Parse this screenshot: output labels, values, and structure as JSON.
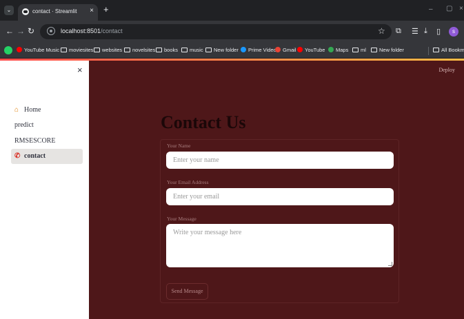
{
  "browser": {
    "tab_title": "contact · Streamlit",
    "tab_close": "×",
    "new_tab": "+",
    "url_host": "localhost:8501",
    "url_path": "/contact",
    "window_controls": {
      "minimize": "–",
      "maximize": "▢",
      "close": "×"
    }
  },
  "bookmarks": [
    {
      "label": "YouTube Music",
      "icon": "youtube-music-icon",
      "color": "#ff0000"
    },
    {
      "label": "moviesites",
      "icon": "folder-icon"
    },
    {
      "label": "websites",
      "icon": "folder-icon"
    },
    {
      "label": "novelsites",
      "icon": "folder-icon"
    },
    {
      "label": "books",
      "icon": "folder-icon"
    },
    {
      "label": "music",
      "icon": "folder-icon"
    },
    {
      "label": "New folder",
      "icon": "folder-icon"
    },
    {
      "label": "Prime Video",
      "icon": "prime-video-icon",
      "color": "#1a98ff"
    },
    {
      "label": "Gmail",
      "icon": "gmail-icon",
      "color": "#ea4335"
    },
    {
      "label": "YouTube",
      "icon": "youtube-icon",
      "color": "#ff0000"
    },
    {
      "label": "Maps",
      "icon": "maps-icon",
      "color": "#34a853"
    },
    {
      "label": "ml",
      "icon": "folder-icon"
    },
    {
      "label": "New folder",
      "icon": "folder-icon"
    },
    {
      "label": "All Bookmarks",
      "icon": "folder-icon"
    }
  ],
  "sidebar": {
    "close": "×",
    "items": [
      {
        "label": "Home",
        "icon": "house-icon"
      },
      {
        "label": "predict"
      },
      {
        "label": "RMSESCORE"
      },
      {
        "label": "contact",
        "icon": "phone-icon",
        "active": true
      }
    ]
  },
  "main": {
    "deploy": "Deploy",
    "title": "Contact Us",
    "form": {
      "name_label": "Your Name",
      "name_placeholder": "Enter your name",
      "email_label": "Your Email Address",
      "email_placeholder": "Enter your email",
      "message_label": "Your Message",
      "message_placeholder": "Write your message here",
      "submit_label": "Send Message"
    }
  },
  "colors": {
    "main_background": "#4e1719",
    "sidebar_background": "#ffffff",
    "accent": "#ff4b4b"
  }
}
